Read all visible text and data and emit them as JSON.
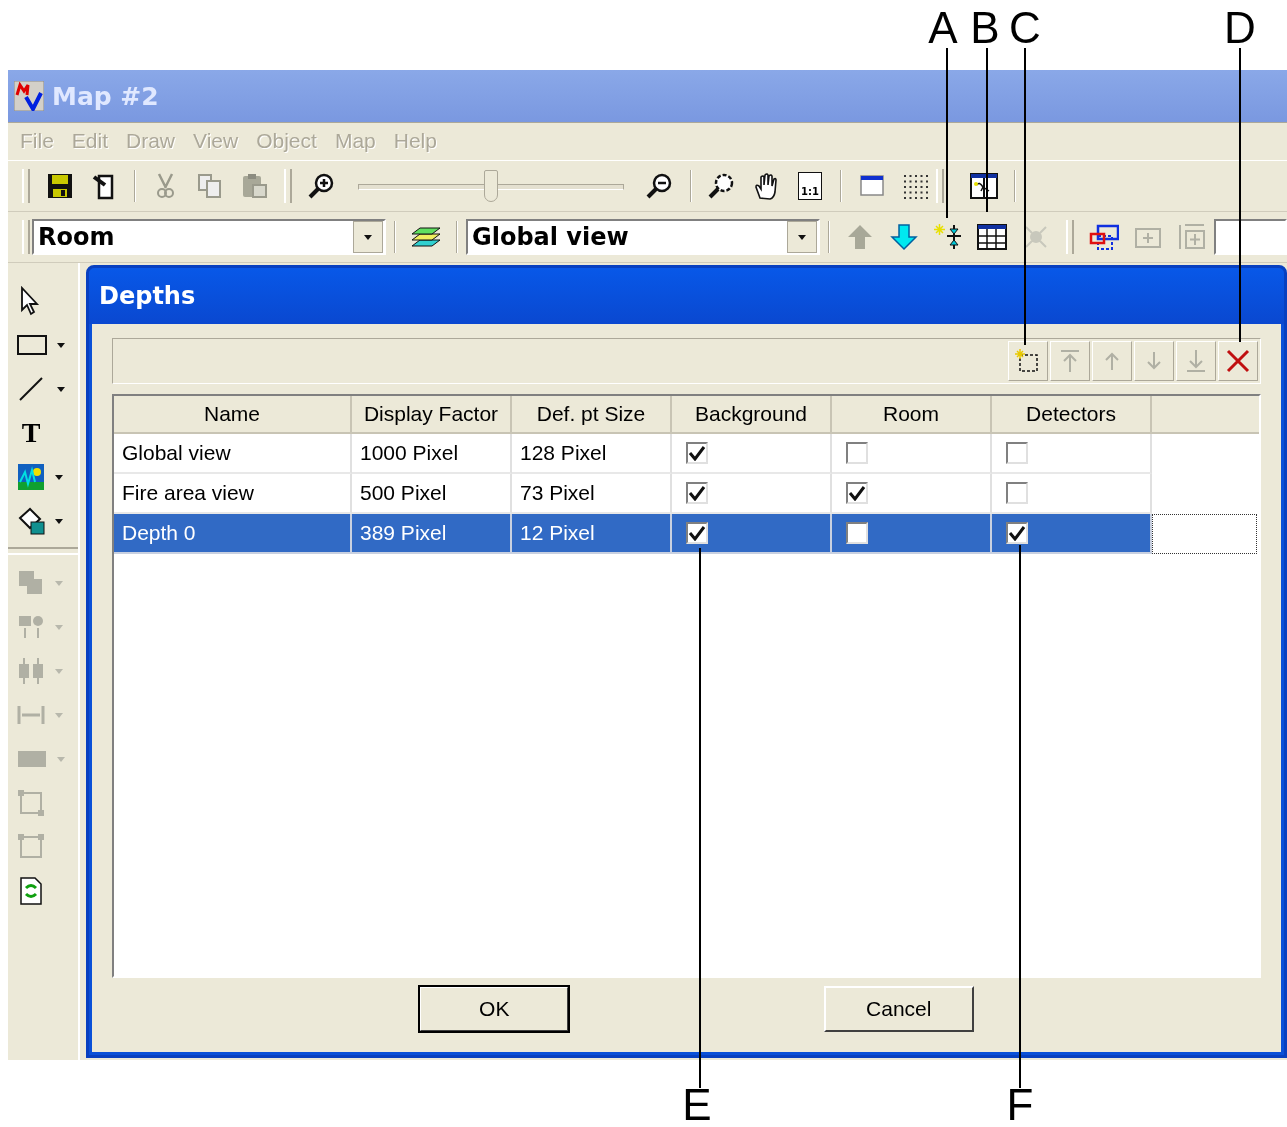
{
  "window": {
    "title": "Map #2"
  },
  "menu": [
    {
      "label": "File",
      "disabled": true
    },
    {
      "label": "Edit",
      "disabled": true
    },
    {
      "label": "Draw",
      "disabled": true
    },
    {
      "label": "View",
      "disabled": true
    },
    {
      "label": "Object",
      "disabled": true
    },
    {
      "label": "Map",
      "disabled": true
    },
    {
      "label": "Help",
      "disabled": true
    }
  ],
  "toolbar": {
    "zoom_slider": {
      "level": 0.5
    },
    "actual_size_label": "1:1"
  },
  "layer_combo": {
    "value": "Room"
  },
  "view_combo": {
    "value": "Global view"
  },
  "palette": {
    "text_tool_label": "T"
  },
  "dialog": {
    "title": "Depths",
    "table": {
      "columns": [
        "Name",
        "Display Factor",
        "Def. pt Size",
        "Background",
        "Room",
        "Detectors"
      ],
      "rows": [
        {
          "name": "Global view",
          "display_factor": "1000 Pixel",
          "def_pt_size": "128 Pixel",
          "background": true,
          "room": false,
          "detectors": false,
          "selected": false
        },
        {
          "name": "Fire area view",
          "display_factor": "500 Pixel",
          "def_pt_size": "73 Pixel",
          "background": true,
          "room": true,
          "detectors": false,
          "selected": false
        },
        {
          "name": "Depth 0",
          "display_factor": "389 Pixel",
          "def_pt_size": "12 Pixel",
          "background": true,
          "room": false,
          "detectors": true,
          "selected": true
        }
      ]
    },
    "buttons": [
      {
        "label": "OK",
        "kind": "default"
      },
      {
        "label": "Cancel",
        "kind": "normal"
      }
    ]
  },
  "callouts": [
    {
      "label": "A"
    },
    {
      "label": "B"
    },
    {
      "label": "C"
    },
    {
      "label": "D"
    },
    {
      "label": "E"
    },
    {
      "label": "F"
    }
  ]
}
